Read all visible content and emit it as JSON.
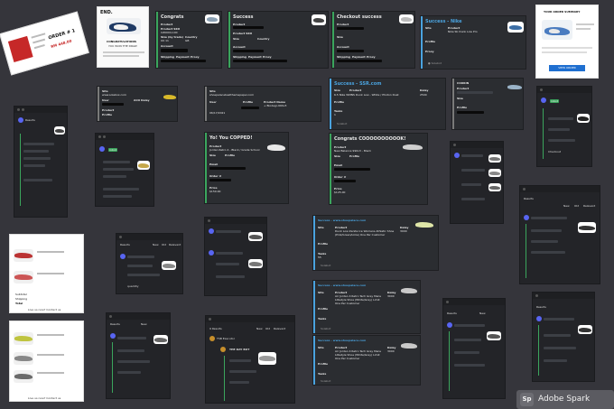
{
  "receipt_top_left": {
    "order_label": "ORDER # 1",
    "price": "RM 448.00"
  },
  "end_email": {
    "brand": "END.",
    "headline": "CONGRATULATIONS",
    "subhead": "YOU WON THE DRAW"
  },
  "congrats_card": {
    "title": "Congrats",
    "product_label": "Product",
    "sku_label": "Product SKU",
    "size_label": "Size (by trade)",
    "country_label": "Country",
    "account_label": "Account",
    "shipping_label": "Shipping",
    "payment_label": "Payment",
    "proxy_label": "Proxy",
    "sku_value": "CZ0004-100",
    "size_value": "UK 11",
    "country_value": "GB"
  },
  "success_card_1": {
    "title": "Success",
    "product_label": "Product",
    "sku_label": "Product SKU",
    "size_label": "Size",
    "country_label": "Country",
    "account_label": "Account",
    "shipping_label": "Shipping",
    "payment_label": "Payment",
    "proxy_label": "Proxy"
  },
  "checkout_card": {
    "title": "Checkout success",
    "product_label": "Product",
    "size_label": "Size",
    "account_label": "Account",
    "shipping_label": "Shipping",
    "payment_label": "Payment",
    "proxy_label": "Proxy"
  },
  "success_nike": {
    "title": "Success - Nike",
    "site_label": "Site",
    "product_label": "Product",
    "profile_label": "Profile",
    "proxy_label": "Proxy",
    "product_value": "Nike Sb Dunk Low Pro"
  },
  "order_summary": {
    "title": "YOUR ORDER SUMMARY",
    "button": "VIEW ORDER"
  },
  "site_card_1": {
    "site_label": "Site",
    "site_value": "www.solebox.com",
    "user_label": "User",
    "aco_label": "ACO Delay",
    "profile_label": "Profile",
    "product_label": "Product"
  },
  "site_card_2": {
    "site_label": "Site",
    "site_value": "shoepalacebestthemepaper.com",
    "user_label": "User",
    "time_value": "06/17/2021",
    "profile_label": "Profile",
    "product_name_label": "Product Name",
    "product_name_value": "+ Biodegr-990v3"
  },
  "success_ssh": {
    "title": "Success - SSR.com",
    "size_label": "Size",
    "product_label": "Product",
    "delay_label": "Delay",
    "product_value": "6.5  Nike WMNS Dunk Low - White / Photon Dust",
    "delay_value": "2500",
    "profile_label": "Profile",
    "tasks_label": "Tasks",
    "tasks_value": "1",
    "footer": "Solebot"
  },
  "cookin_card": {
    "title": "COOKIN",
    "product_label": "Product",
    "size_label": "Size",
    "profile_label": "Profile"
  },
  "you_copped": {
    "title": "Yo! You COPPED!",
    "product_label": "Product",
    "product_value": "Jordan Retro 4 - Black / Grade School",
    "size_label": "Size",
    "profile_label": "Profile",
    "email_label": "Email",
    "order_label": "Order #",
    "price_label": "Price",
    "price_value": "$150.00"
  },
  "congrats_big": {
    "title": "Congrats COOOOOOOOOOK!",
    "product_label": "Product",
    "product_value": "New Balance 990v3 - Black",
    "size_label": "Size",
    "profile_label": "Profile",
    "email_label": "Email",
    "order_label": "Order #",
    "price_label": "Price",
    "price_value": "$125.00"
  },
  "sp_success_1": {
    "title": "Success - www.shoepalace.com",
    "site_label": "Site",
    "product_label": "Product",
    "delay_label": "Delay",
    "product_value": "Dunk Low Zenita Ice Womens Athletic Shoe (Pink/Green/Lime) One Per Customer",
    "delay_value": "3000",
    "profile_label": "Profile",
    "tasks_label": "Tasks",
    "tasks_value": "55",
    "footer": "Solebot"
  },
  "sp_success_2": {
    "title": "Success - www.shoepalace.com",
    "site_label": "Site",
    "product_label": "Product",
    "delay_label": "Delay",
    "product_value": "Air Jordan 4 Retro Tech Grey Mens Lifestyle Shoe (White/Grey) Limit One Per Customer",
    "delay_value": "3000",
    "profile_label": "Profile",
    "tasks_label": "Tasks",
    "footer": "Solebot"
  },
  "sp_success_3": {
    "title": "Success - www.shoepalace.com",
    "site_label": "Site",
    "product_label": "Product",
    "delay_label": "Delay",
    "product_value": "Air Jordan 4 Retro Tech Grey Mens Lifestyle Shoe (White/Grey) Limit One Per Customer",
    "delay_value": "3000",
    "profile_label": "Profile",
    "tasks_label": "Tasks",
    "footer": "Solebot"
  },
  "discord_panels": {
    "results_label": "Results",
    "new_label": "New",
    "old_label": "Old",
    "relevant_label": "Relevant",
    "robot_label": "robot",
    "quantity_label": "quantity",
    "checkout_label": "Checkout"
  },
  "discord_small": {
    "result_title": "9 Results",
    "tab_new": "New",
    "tab_old": "Old",
    "tab_relevant": "Relevant",
    "bot_label": "TSB Executor",
    "drop_title": "THE DAY BOT"
  },
  "receipts_white": {
    "subtotal_label": "Subtotal",
    "shipping_label": "Shipping",
    "total_label": "Total",
    "contact_label": "Live us now? Contact us"
  },
  "watermark": {
    "logo": "Sp",
    "text": "Adobe Spark"
  }
}
